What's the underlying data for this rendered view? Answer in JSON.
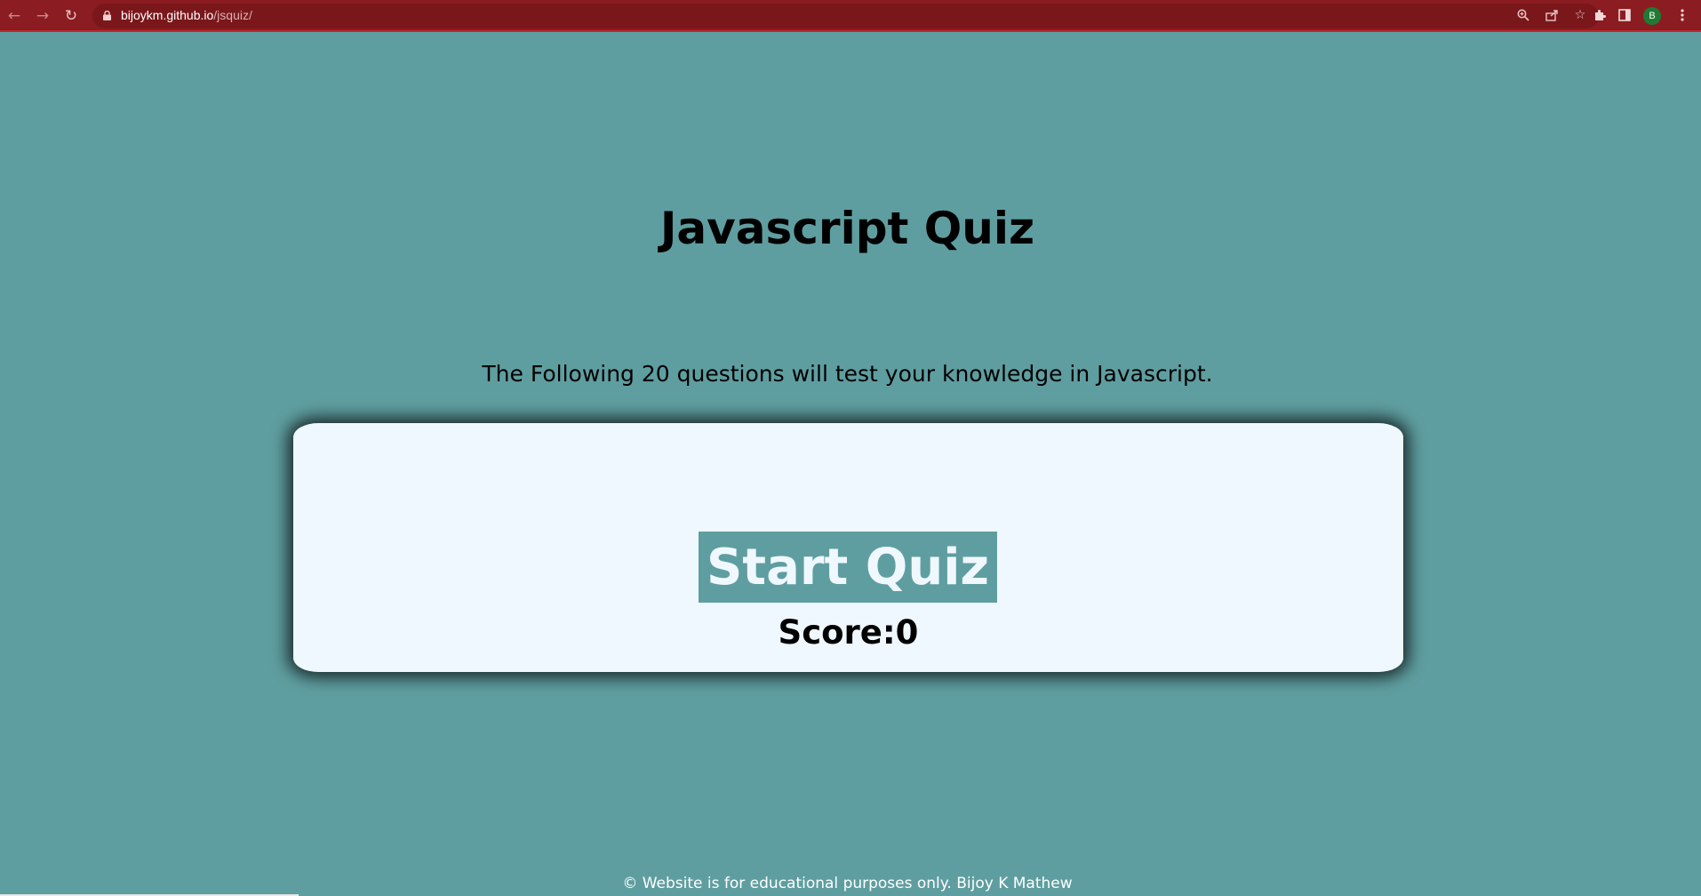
{
  "browser": {
    "url_host": "bijoykm.github.io",
    "url_path": "/jsquiz/",
    "nav_icons": [
      "back-arrow-icon",
      "forward-arrow-icon",
      "reload-icon"
    ],
    "url_icons": [
      "zoom-icon",
      "share-icon",
      "bookmark-star-icon"
    ],
    "toolbar_icons": [
      "extensions-icon",
      "side-panel-icon",
      "profile-avatar",
      "menu-kebab-icon"
    ],
    "profile_initial": "B",
    "colors": {
      "frame": "#8b1c21",
      "omnibox": "#7a171b",
      "avatar": "#1f7a33"
    }
  },
  "page": {
    "title": "Javascript Quiz",
    "intro": "The Following 20 questions will test your knowledge in Javascript.",
    "start_button_label": "Start Quiz",
    "score_label": "Score:0",
    "footer": "© Website is for educational purposes only. Bijoy K Mathew",
    "colors": {
      "background": "#5f9ea0",
      "card": "#f0f8ff",
      "button": "#5f9ea0",
      "button_text": "#f0f8ff"
    }
  }
}
